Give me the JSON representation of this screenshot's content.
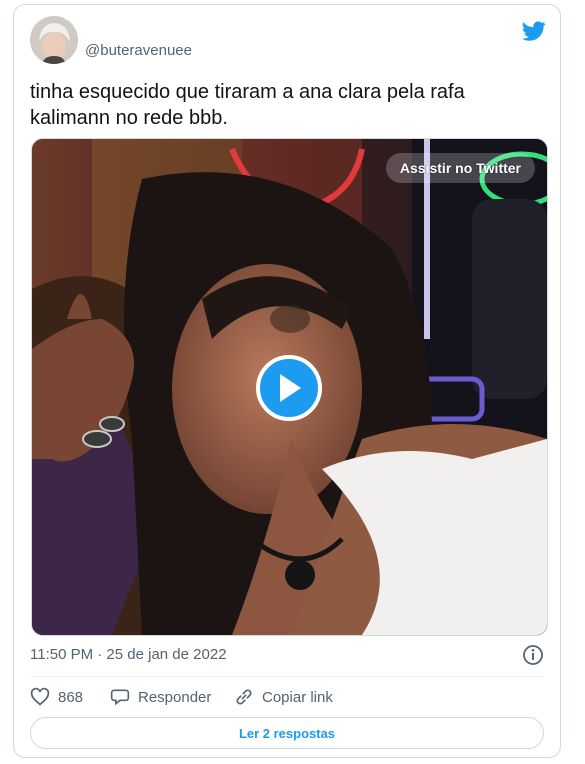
{
  "tweet": {
    "handle": "@buteravenuee",
    "text": "tinha esquecido que tiraram a ana clara pela rafa kalimann no rede bbb.",
    "timestamp": "11:50 PM · 25 de jan de 2022"
  },
  "media": {
    "watch_label": "Assistir no Twitter",
    "play_icon": "play-icon"
  },
  "actions": {
    "like_count": "868",
    "reply_label": "Responder",
    "copy_link_label": "Copiar link"
  },
  "footer": {
    "read_replies_label": "Ler 2 respostas"
  },
  "colors": {
    "accent": "#1d9bf0",
    "secondary_text": "#536471",
    "border": "#cfd9de"
  }
}
